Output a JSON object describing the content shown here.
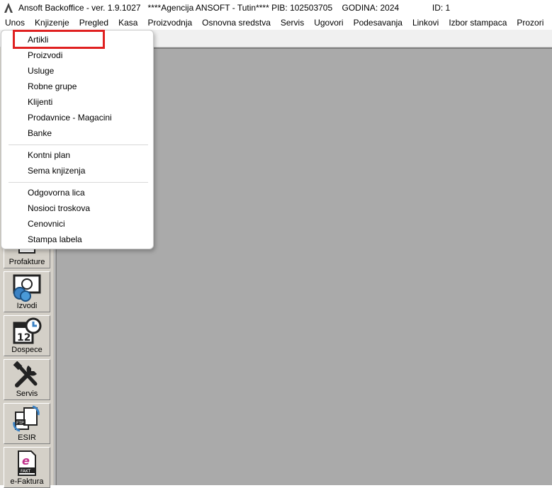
{
  "window": {
    "title": "Ansoft Backoffice - ver. 1.9.1027   ****Agencija ANSOFT - Tutin**** PIB: 102503705    GODINA: 2024              ID: 1"
  },
  "menubar": {
    "items": [
      "Unos",
      "Knjizenje",
      "Pregled",
      "Kasa",
      "Proizvodnja",
      "Osnovna sredstva",
      "Servis",
      "Ugovori",
      "Podesavanja",
      "Linkovi",
      "Izbor stampaca",
      "Prozori"
    ]
  },
  "dropdown": {
    "group1": [
      "Artikli",
      "Proizvodi",
      "Usluge",
      "Robne grupe",
      "Klijenti",
      "Prodavnice - Magacini",
      "Banke"
    ],
    "group2": [
      "Kontni plan",
      "Sema knjizenja"
    ],
    "group3": [
      "Odgovorna lica",
      "Nosioci troskova",
      "Cenovnici",
      "Stampa labela"
    ]
  },
  "sidebar": {
    "buttons": [
      {
        "label": "Profakture",
        "icon": "invoice-icon"
      },
      {
        "label": "Izvodi",
        "icon": "coins-icon"
      },
      {
        "label": "Dospece",
        "icon": "calendar-clock-icon"
      },
      {
        "label": "Servis",
        "icon": "tools-icon"
      },
      {
        "label": "ESIR",
        "icon": "ftp-documents-icon"
      },
      {
        "label": "e-Faktura",
        "icon": "e-invoice-icon"
      }
    ]
  },
  "colors": {
    "highlight": "#e02020",
    "workspace": "#aaaaaa"
  }
}
